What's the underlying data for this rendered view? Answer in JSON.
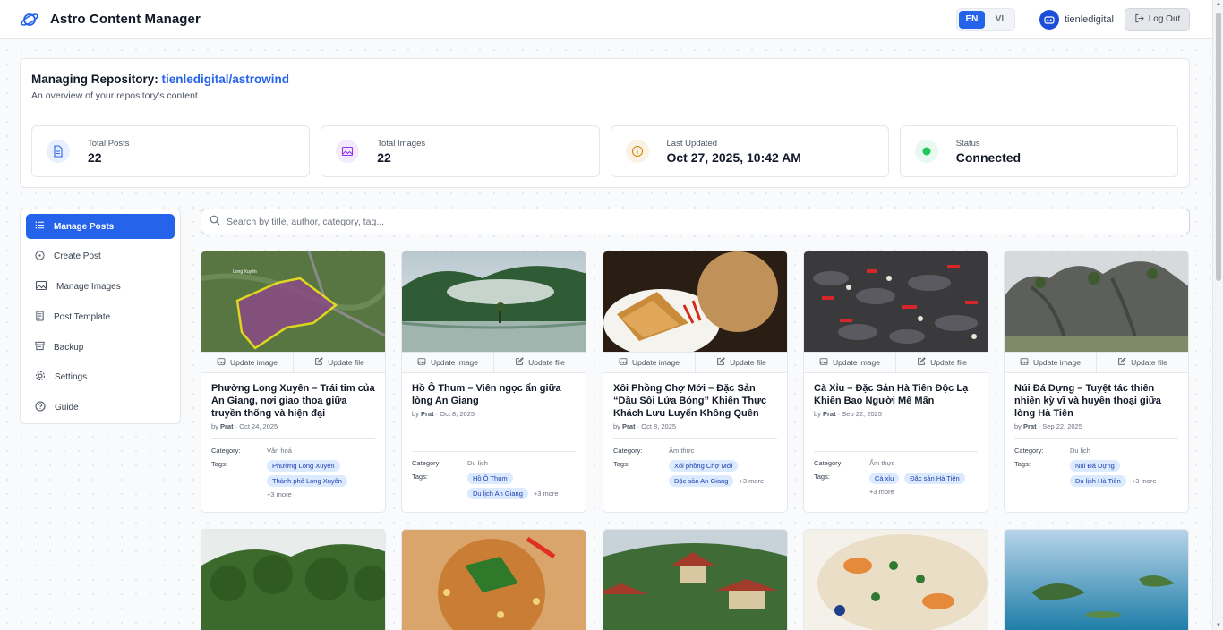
{
  "header": {
    "title": "Astro Content Manager",
    "lang": [
      "EN",
      "VI"
    ],
    "active_lang": "EN",
    "user": "tienledigital",
    "logout": "Log Out"
  },
  "overview": {
    "title_prefix": "Managing Repository:",
    "repo": "tienledigital/astrowind",
    "subtitle": "An overview of your repository's content.",
    "stats": [
      {
        "label": "Total Posts",
        "value": "22",
        "icon": "document-icon",
        "color": "#2563eb"
      },
      {
        "label": "Total Images",
        "value": "22",
        "icon": "image-icon",
        "color": "#9333ea"
      },
      {
        "label": "Last Updated",
        "value": "Oct 27, 2025, 10:42 AM",
        "icon": "info-icon",
        "color": "#ca8a04"
      },
      {
        "label": "Status",
        "value": "Connected",
        "icon": "status-dot-icon",
        "color": "#22c55e"
      }
    ]
  },
  "sidebar": {
    "items": [
      {
        "label": "Manage Posts",
        "icon": "list-icon",
        "active": true
      },
      {
        "label": "Create Post",
        "icon": "plus-circle-icon"
      },
      {
        "label": "Manage Images",
        "icon": "image-icon"
      },
      {
        "label": "Post Template",
        "icon": "template-icon"
      },
      {
        "label": "Backup",
        "icon": "archive-icon"
      },
      {
        "label": "Settings",
        "icon": "gear-icon"
      },
      {
        "label": "Guide",
        "icon": "help-circle-icon"
      }
    ]
  },
  "search": {
    "placeholder": "Search by title, author, category, tag..."
  },
  "card_labels": {
    "update_image": "Update image",
    "update_file": "Update file",
    "by": "by",
    "category": "Category:",
    "tags": "Tags:"
  },
  "posts": [
    {
      "title": "Phường Long Xuyên – Trái tim của An Giang, nơi giao thoa giữa truyền thống và hiện đại",
      "author": "Prat",
      "date": "Oct 24, 2025",
      "category": "Văn hoá",
      "tags": [
        "Phường Long Xuyên",
        "Thành phố Long Xuyên"
      ],
      "more": "+3 more",
      "thumb": "map"
    },
    {
      "title": "Hồ Ô Thum – Viên ngọc ẩn giữa lòng An Giang",
      "author": "Prat",
      "date": "Oct 8, 2025",
      "category": "Du lịch",
      "tags": [
        "Hồ Ô Thum",
        "Du lịch An Giang"
      ],
      "more": "+3 more",
      "thumb": "lake"
    },
    {
      "title": "Xôi Phồng Chợ Mới – Đặc Sản “Dầu Sôi Lửa Bỏng” Khiến Thực Khách Lưu Luyến Không Quên",
      "author": "Prat",
      "date": "Oct 8, 2025",
      "category": "Ẩm thực",
      "tags": [
        "Xôi phồng Chợ Mới",
        "Đặc sản An Giang"
      ],
      "more": "+3 more",
      "thumb": "food"
    },
    {
      "title": "Cà Xỉu – Đặc Sản Hà Tiên Độc Lạ Khiến Bao Người Mê Mẩn",
      "author": "Prat",
      "date": "Sep 22, 2025",
      "category": "Ẩm thực",
      "tags": [
        "Cà xỉu",
        "Đặc sản Hà Tiên"
      ],
      "more": "+3 more",
      "thumb": "seafood"
    },
    {
      "title": "Núi Đá Dựng – Tuyệt tác thiên nhiên kỳ vĩ và huyền thoại giữa lòng Hà Tiên",
      "author": "Prat",
      "date": "Sep 22, 2025",
      "category": "Du lịch",
      "tags": [
        "Núi Đá Dựng",
        "Du lịch Hà Tiên"
      ],
      "more": "+3 more",
      "thumb": "cliff"
    }
  ],
  "posts_row2": [
    "forest",
    "salad",
    "pagoda",
    "dish",
    "coast"
  ]
}
